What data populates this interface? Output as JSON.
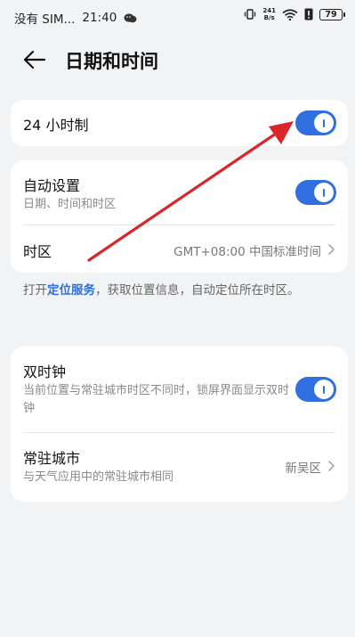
{
  "status_bar": {
    "carrier": "没有 SIM...",
    "time": "21:40",
    "net_speed_value": "241",
    "net_speed_unit": "B/s",
    "battery": "79"
  },
  "header": {
    "title": "日期和时间"
  },
  "card1": {
    "title": "24 小时制",
    "toggle_on": true
  },
  "card2": {
    "auto_title": "自动设置",
    "auto_sub": "日期、时间和时区",
    "auto_toggle_on": true,
    "tz_title": "时区",
    "tz_value": "GMT+08:00 中国标准时间"
  },
  "note": {
    "before": "打开",
    "link": "定位服务",
    "after": "，获取位置信息，自动定位所在时区。"
  },
  "card3": {
    "dual_title": "双时钟",
    "dual_sub": "当前位置与常驻城市时区不同时，锁屏界面显示双时钟",
    "dual_toggle_on": true,
    "city_title": "常驻城市",
    "city_sub": "与天气应用中的常驻城市相同",
    "city_value": "新吴区"
  },
  "colors": {
    "accent": "#2f6fe0",
    "annotation_arrow": "#d9262b",
    "background": "#f1f3f5"
  }
}
